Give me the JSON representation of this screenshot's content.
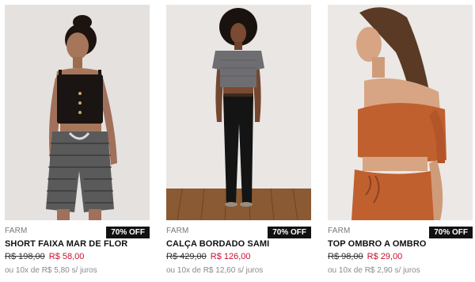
{
  "products": [
    {
      "brand": "FARM",
      "discount_badge": "70% OFF",
      "name": "SHORT FAIXA MAR DE FLOR",
      "old_price": "R$ 198,00",
      "new_price": "R$ 58,00",
      "installments": "ou 10x de R$ 5,80 s/ juros"
    },
    {
      "brand": "FARM",
      "discount_badge": "70% OFF",
      "name": "CALÇA BORDADO SAMI",
      "old_price": "R$ 429,00",
      "new_price": "R$ 126,00",
      "installments": "ou 10x de R$ 12,60 s/ juros"
    },
    {
      "brand": "FARM",
      "discount_badge": "70% OFF",
      "name": "TOP OMBRO A OMBRO",
      "old_price": "R$ 98,00",
      "new_price": "R$ 29,00",
      "installments": "ou 10x de R$ 2,90 s/ juros"
    }
  ],
  "colors": {
    "sale_price": "#c8102e",
    "badge_bg": "#111111",
    "installments_text": "#8a8a8a"
  }
}
